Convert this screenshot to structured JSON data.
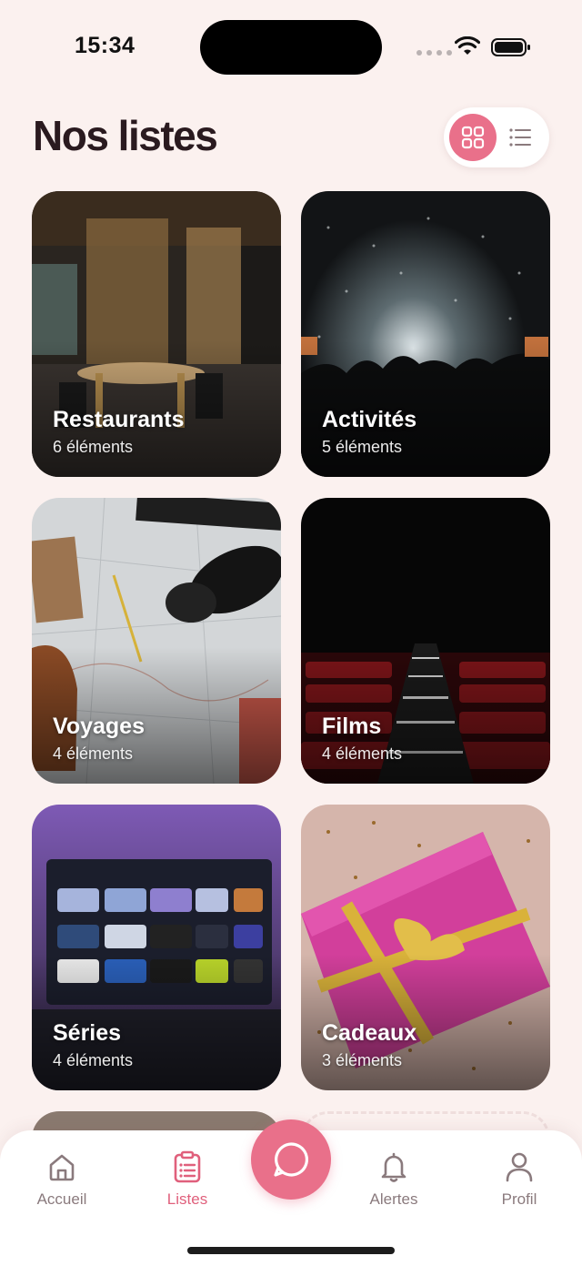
{
  "status_bar": {
    "time": "15:34"
  },
  "header": {
    "title": "Nos listes"
  },
  "view_toggle": {
    "active": "grid"
  },
  "cards": [
    {
      "title": "Restaurants",
      "count": "6 éléments"
    },
    {
      "title": "Activités",
      "count": "5 éléments"
    },
    {
      "title": "Voyages",
      "count": "4 éléments"
    },
    {
      "title": "Films",
      "count": "4 éléments"
    },
    {
      "title": "Séries",
      "count": "4 éléments"
    },
    {
      "title": "Cadeaux",
      "count": "3 éléments"
    }
  ],
  "tab_bar": {
    "items": [
      {
        "label": "Accueil",
        "icon": "home-icon"
      },
      {
        "label": "Listes",
        "icon": "clipboard-icon"
      },
      {
        "label": "Alertes",
        "icon": "bell-icon"
      },
      {
        "label": "Profil",
        "icon": "user-icon"
      }
    ],
    "active": "Listes",
    "fab_icon": "chat-icon"
  },
  "colors": {
    "accent": "#e9708a",
    "background": "#fbf1ef",
    "text": "#2a1a1f",
    "muted": "#8a7a7d"
  }
}
